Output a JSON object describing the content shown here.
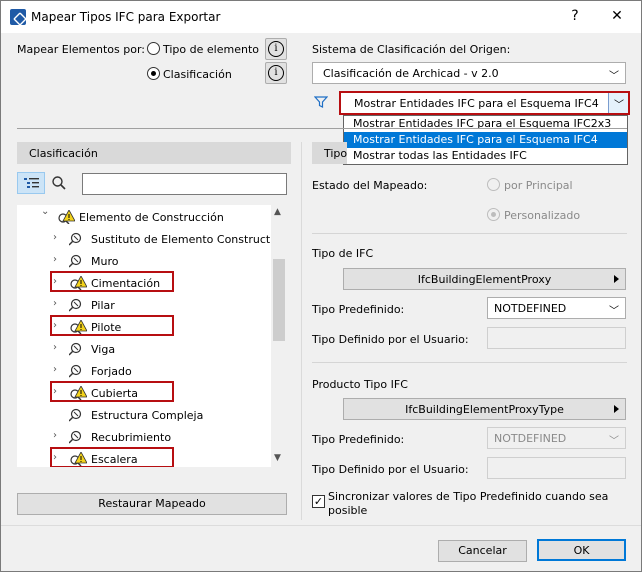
{
  "window": {
    "title": "Mapear Tipos IFC para Exportar",
    "help_glyph": "?",
    "close_glyph": "✕"
  },
  "map_by": {
    "label": "Mapear Elementos por:",
    "options": [
      {
        "label": "Tipo de elemento",
        "selected": false
      },
      {
        "label": "Clasificación",
        "selected": true
      }
    ]
  },
  "origin": {
    "label": "Sistema de Clasificación del Origen:",
    "system": "Clasificación de Archicad - v 2.0",
    "filter_selected": "Mostrar Entidades IFC para el Esquema IFC4",
    "filter_options": [
      {
        "label": "Mostrar Entidades IFC para el Esquema IFC2x3",
        "selected": false
      },
      {
        "label": "Mostrar Entidades IFC para el Esquema IFC4",
        "selected": true
      },
      {
        "label": "Mostrar todas las Entidades IFC",
        "selected": false
      }
    ]
  },
  "left_panel": {
    "header": "Clasificación",
    "search_value": "",
    "tree": [
      {
        "label": "Elemento de Construcción",
        "icon": "warning-icon",
        "expanded": true,
        "highlighted": false
      },
      {
        "label": "Sustituto de Elemento Constructivo",
        "icon": "search-class-icon",
        "highlighted": false
      },
      {
        "label": "Muro",
        "icon": "search-class-icon",
        "highlighted": false
      },
      {
        "label": "Cimentación",
        "icon": "warning-icon",
        "highlighted": true
      },
      {
        "label": "Pilar",
        "icon": "search-class-icon",
        "highlighted": false
      },
      {
        "label": "Pilote",
        "icon": "warning-icon",
        "highlighted": true
      },
      {
        "label": "Viga",
        "icon": "search-class-icon",
        "highlighted": false
      },
      {
        "label": "Forjado",
        "icon": "search-class-icon",
        "highlighted": false
      },
      {
        "label": "Cubierta",
        "icon": "warning-icon",
        "highlighted": true
      },
      {
        "label": "Estructura Compleja",
        "icon": "search-class-icon",
        "highlighted": false
      },
      {
        "label": "Recubrimiento",
        "icon": "search-class-icon",
        "highlighted": false
      },
      {
        "label": "Escalera",
        "icon": "warning-icon",
        "highlighted": true
      }
    ],
    "restore_label": "Restaurar Mapeado"
  },
  "right_panel": {
    "header": "Tipo",
    "mapping_state_label": "Estado del Mapeado:",
    "mapping_options": [
      {
        "label": "por Principal",
        "selected": false
      },
      {
        "label": "Personalizado",
        "selected": true
      }
    ],
    "ifc_type_label": "Tipo de IFC",
    "ifc_type_value": "IfcBuildingElementProxy",
    "predefined_label": "Tipo Predefinido:",
    "predefined_value": "NOTDEFINED",
    "user_defined_label": "Tipo Definido por el Usuario:",
    "user_defined_value": "",
    "product_type_label": "Producto Tipo IFC",
    "product_type_value": "IfcBuildingElementProxyType",
    "predefined2_label": "Tipo Predefinido:",
    "predefined2_value": "NOTDEFINED",
    "user_defined2_label": "Tipo Definido por el Usuario:",
    "user_defined2_value": "",
    "sync_label_line1": "Sincronizar valores de Tipo Predefinido cuando sea",
    "sync_label_line2": "posible",
    "sync_checked": true,
    "sync_mark": "✓"
  },
  "footer": {
    "cancel_label": "Cancelar",
    "ok_label": "OK"
  },
  "colors": {
    "highlight_border": "#b70e11",
    "selection": "#0078d7",
    "warning": "#f2d21b"
  }
}
